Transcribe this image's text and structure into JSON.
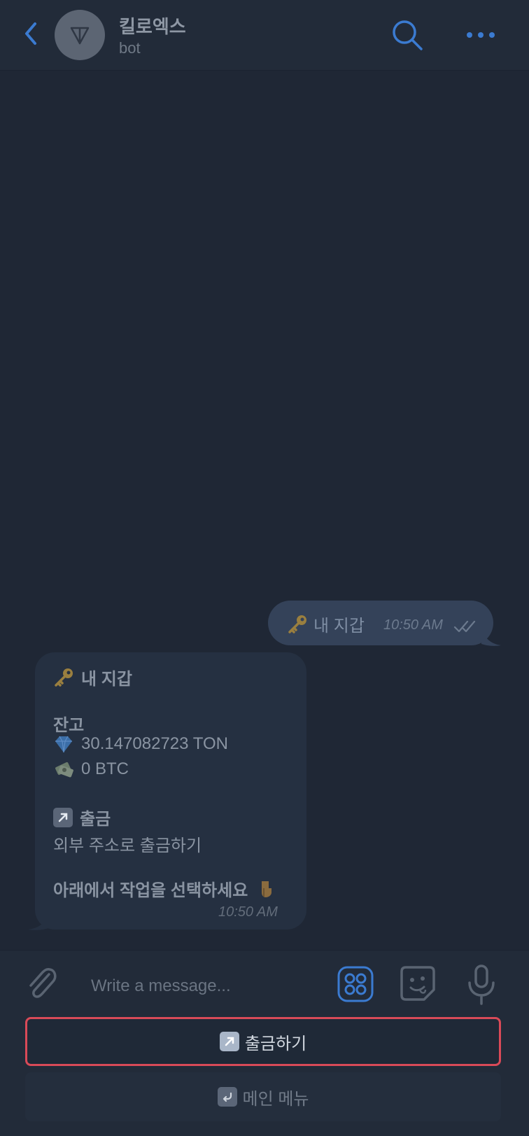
{
  "header": {
    "title": "킬로엑스",
    "subtitle": "bot"
  },
  "messages": [
    {
      "direction": "outgoing",
      "text": "내 지갑",
      "time": "10:50 AM"
    },
    {
      "direction": "incoming",
      "heading": "내 지갑",
      "balance_label": "잔고",
      "ton_balance": "30.147082723 TON",
      "btc_balance": "0 BTC",
      "withdraw_label": "출금",
      "withdraw_desc": "외부 주소로 출금하기",
      "prompt": "아래에서 작업을 선택하세요",
      "time": "10:50 AM"
    }
  ],
  "composer": {
    "placeholder": "Write a message..."
  },
  "keyboard": {
    "buttons": [
      "출금하기",
      "메인 메뉴"
    ]
  },
  "colors": {
    "accent": "#3b7bd1",
    "highlight_border": "#d94a58",
    "background": "#1f2735"
  }
}
